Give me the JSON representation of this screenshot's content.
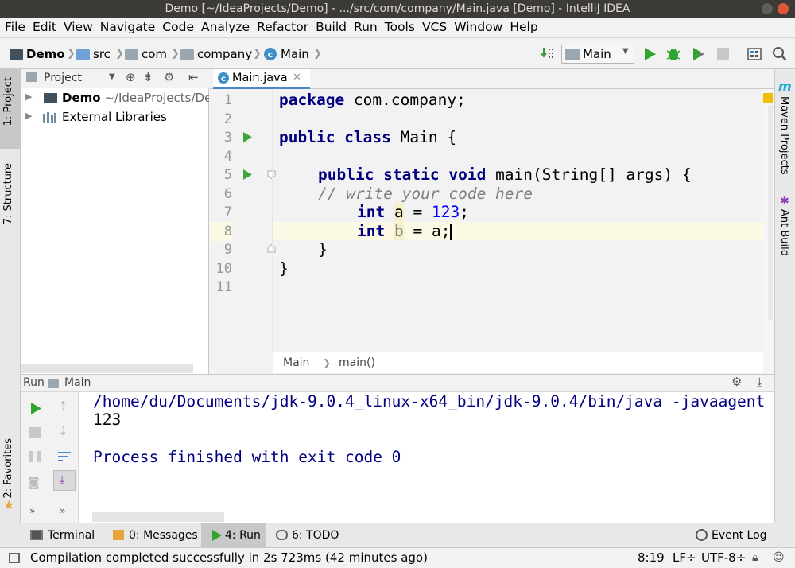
{
  "window": {
    "title": "Demo [~/IdeaProjects/Demo] - .../src/com/company/Main.java [Demo] - IntelliJ IDEA"
  },
  "menu": [
    "File",
    "Edit",
    "View",
    "Navigate",
    "Code",
    "Analyze",
    "Refactor",
    "Build",
    "Run",
    "Tools",
    "VCS",
    "Window",
    "Help"
  ],
  "breadcrumbs": {
    "project": "Demo",
    "src": "src",
    "com": "com",
    "company": "company",
    "file": "Main"
  },
  "run_config": {
    "selected": "Main"
  },
  "project_panel": {
    "title": "Project",
    "tree": [
      {
        "name": "Demo",
        "path": "~/IdeaProjects/Demo"
      },
      {
        "name": "External Libraries"
      }
    ]
  },
  "left_tabs": {
    "project": "1: Project",
    "structure": "7: Structure",
    "favorites": "2: Favorites"
  },
  "right_tabs": {
    "maven": "Maven Projects",
    "ant": "Ant Build"
  },
  "editor": {
    "tab_label": "Main.java",
    "lines": [
      {
        "n": "1"
      },
      {
        "n": "2"
      },
      {
        "n": "3"
      },
      {
        "n": "4"
      },
      {
        "n": "5"
      },
      {
        "n": "6"
      },
      {
        "n": "7"
      },
      {
        "n": "8"
      },
      {
        "n": "9"
      },
      {
        "n": "10"
      },
      {
        "n": "11"
      }
    ],
    "code": {
      "l1_kw": "package",
      "l1_rest": " com.company;",
      "l3_kw": "public class",
      "l3_rest": " Main {",
      "l5_kw": "public static void",
      "l5_rest": " main(String[] args) {",
      "l6": "// write your code here",
      "l7_kw": "int",
      "l7_var": "a",
      "l7_mid": " = ",
      "l7_num": "123",
      "l7_end": ";",
      "l8_kw": "int",
      "l8_var": "b",
      "l8_rest": " = a;",
      "l9": "}",
      "l10": "}"
    },
    "breadcrumb": {
      "class": "Main",
      "method": "main()"
    }
  },
  "run_panel": {
    "label": "Run",
    "config": "Main",
    "output": [
      "/home/du/Documents/jdk-9.0.4_linux-x64_bin/jdk-9.0.4/bin/java -javaagent",
      "123",
      "",
      "Process finished with exit code 0"
    ]
  },
  "bottom_tabs": {
    "terminal": "Terminal",
    "messages": "0: Messages",
    "run": "4: Run",
    "todo": "6: TODO",
    "event_log": "Event Log"
  },
  "status": {
    "message": "Compilation completed successfully in 2s 723ms (42 minutes ago)",
    "position": "8:19",
    "line_sep": "LF÷",
    "encoding": "UTF-8÷"
  },
  "colors": {
    "keyword": "#000080",
    "number": "#0000ff",
    "comment": "#808080",
    "run_green": "#2fa42f",
    "accent_blue": "#4a88c7"
  }
}
